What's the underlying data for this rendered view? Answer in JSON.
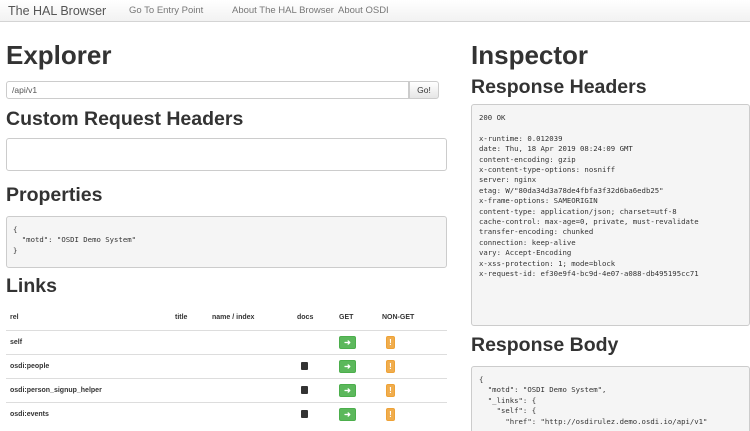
{
  "navbar": {
    "brand": "The HAL Browser",
    "links": [
      "Go To Entry Point",
      "About The HAL Browser",
      "About OSDI"
    ]
  },
  "explorer": {
    "title": "Explorer",
    "url_value": "/api/v1",
    "go_label": "Go!",
    "custom_headers_title": "Custom Request Headers",
    "properties_title": "Properties",
    "properties_json": "{\n  \"motd\": \"OSDI Demo System\"\n}",
    "links_title": "Links",
    "links_table": {
      "headers": [
        "rel",
        "title",
        "name / index",
        "docs",
        "GET",
        "NON-GET"
      ],
      "rows": [
        {
          "rel": "self",
          "docs": false
        },
        {
          "rel": "osdi:people",
          "docs": true
        },
        {
          "rel": "osdi:person_signup_helper",
          "docs": true
        },
        {
          "rel": "osdi:events",
          "docs": true
        }
      ]
    }
  },
  "inspector": {
    "title": "Inspector",
    "response_headers_title": "Response Headers",
    "response_headers": "200 OK\n\nx-runtime: 0.012039\ndate: Thu, 18 Apr 2019 08:24:09 GMT\ncontent-encoding: gzip\nx-content-type-options: nosniff\nserver: nginx\netag: W/\"80da34d3a78de4fbfa3f32d6ba6edb25\"\nx-frame-options: SAMEORIGIN\ncontent-type: application/json; charset=utf-8\ncache-control: max-age=0, private, must-revalidate\ntransfer-encoding: chunked\nconnection: keep-alive\nvary: Accept-Encoding\nx-xss-protection: 1; mode=block\nx-request-id: ef30e9f4-bc9d-4e07-a088-db495195cc71",
    "response_body_title": "Response Body",
    "response_body": "{\n  \"motd\": \"OSDI Demo System\",\n  \"_links\": {\n    \"self\": {\n      \"href\": \"http://osdirulez.demo.osdi.io/api/v1\""
  }
}
